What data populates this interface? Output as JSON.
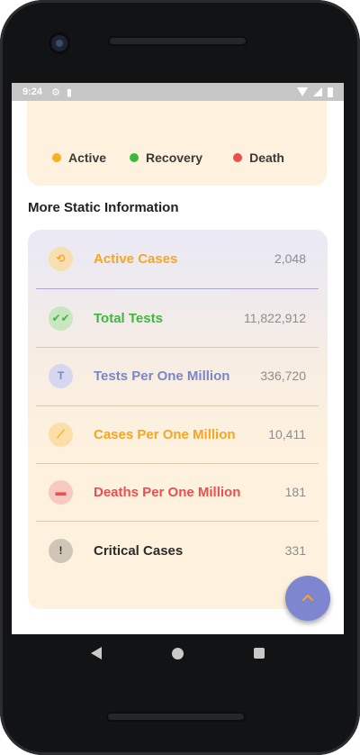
{
  "status_bar": {
    "time": "9:24",
    "icons": [
      "gear-icon",
      "sd-card-icon",
      "wifi-icon",
      "signal-icon",
      "battery-icon"
    ]
  },
  "legend": {
    "items": [
      {
        "label": "Active",
        "color": "#f8b21e"
      },
      {
        "label": "Recovery",
        "color": "#3cb93c"
      },
      {
        "label": "Death",
        "color": "#e9504f"
      }
    ]
  },
  "section": {
    "title": "More Static Information"
  },
  "stats": [
    {
      "label": "Active Cases",
      "value": "2,048",
      "color": "#f5a623",
      "icon": "history-icon",
      "icon_bg": "#f9dfb0",
      "icon_glyph": "⟲"
    },
    {
      "label": "Total Tests",
      "value": "11,822,912",
      "color": "#3cb93c",
      "icon": "double-check-icon",
      "icon_bg": "#c8e6c0",
      "icon_glyph": "✔✔"
    },
    {
      "label": "Tests Per One Million",
      "value": "336,720",
      "color": "#7986cb",
      "icon": "t-letter-icon",
      "icon_bg": "#d7d6ef",
      "icon_glyph": "T"
    },
    {
      "label": "Cases Per One Million",
      "value": "10,411",
      "color": "#f5a623",
      "icon": "trending-up-icon",
      "icon_bg": "#fbdfa7",
      "icon_glyph": "⟋"
    },
    {
      "label": "Deaths Per One Million",
      "value": "181",
      "color": "#e9504f",
      "icon": "bed-icon",
      "icon_bg": "#f8c9c2",
      "icon_glyph": "▬"
    },
    {
      "label": "Critical Cases",
      "value": "331",
      "color": "#2c2c2c",
      "icon": "alert-icon",
      "icon_bg": "#cfc6b8",
      "icon_glyph": "!"
    }
  ],
  "fab": {
    "icon": "chevron-up-icon",
    "color": "#7e86d0",
    "icon_color": "#f5a623"
  }
}
